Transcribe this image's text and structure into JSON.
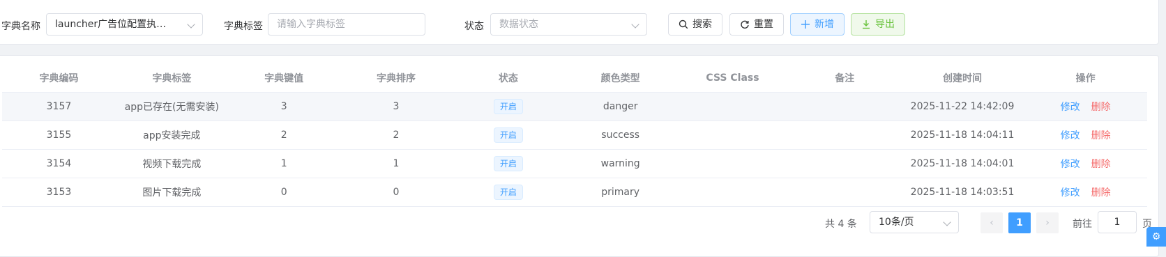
{
  "filters": {
    "dict_name_label": "字典名称",
    "dict_name_value": "launcher广告位配置执行记…",
    "dict_label_label": "字典标签",
    "dict_label_placeholder": "请输入字典标签",
    "status_label": "状态",
    "status_placeholder": "数据状态"
  },
  "toolbar": {
    "search_label": "搜索",
    "reset_label": "重置",
    "add_label": "新增",
    "export_label": "导出"
  },
  "table": {
    "headers": [
      "字典编码",
      "字典标签",
      "字典键值",
      "字典排序",
      "状态",
      "颜色类型",
      "CSS Class",
      "备注",
      "创建时间",
      "操作"
    ],
    "rows": [
      {
        "code": "3157",
        "label": "app已存在(无需安装)",
        "value": "3",
        "sort": "3",
        "status": "开启",
        "color": "danger",
        "css": "",
        "remark": "",
        "created": "2025-11-22 14:42:09"
      },
      {
        "code": "3155",
        "label": "app安装完成",
        "value": "2",
        "sort": "2",
        "status": "开启",
        "color": "success",
        "css": "",
        "remark": "",
        "created": "2025-11-18 14:04:11"
      },
      {
        "code": "3154",
        "label": "视频下载完成",
        "value": "1",
        "sort": "1",
        "status": "开启",
        "color": "warning",
        "css": "",
        "remark": "",
        "created": "2025-11-18 14:04:01"
      },
      {
        "code": "3153",
        "label": "图片下载完成",
        "value": "0",
        "sort": "0",
        "status": "开启",
        "color": "primary",
        "css": "",
        "remark": "",
        "created": "2025-11-18 14:03:51"
      }
    ],
    "edit_label": "修改",
    "delete_label": "删除"
  },
  "pagination": {
    "total_text": "共 4 条",
    "page_size": "10条/页",
    "current_page": "1",
    "goto_label": "前往",
    "goto_value": "1",
    "goto_suffix": "页"
  },
  "colors": {
    "primary": "#409eff",
    "danger": "#f56c6c",
    "success": "#67c23a"
  },
  "icons": {
    "search": "search-icon",
    "reset": "refresh-icon",
    "add": "plus-icon",
    "export": "download-icon",
    "settings": "gear-icon"
  }
}
